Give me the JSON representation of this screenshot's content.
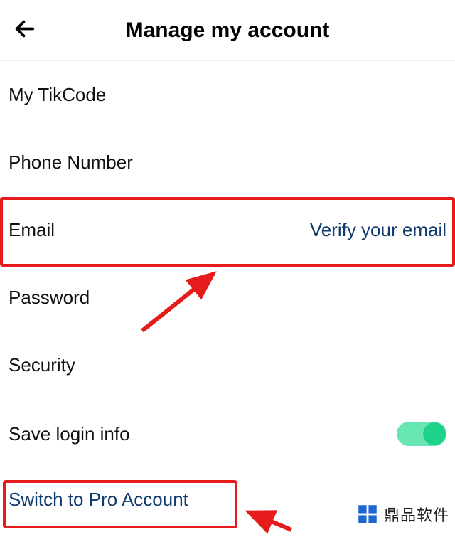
{
  "header": {
    "title": "Manage my account"
  },
  "items": {
    "tikcode": {
      "label": "My TikCode"
    },
    "phone": {
      "label": "Phone Number"
    },
    "email": {
      "label": "Email",
      "value": "Verify your email"
    },
    "password": {
      "label": "Password"
    },
    "security": {
      "label": "Security"
    },
    "savelogin": {
      "label": "Save login info"
    }
  },
  "switch_pro": {
    "label": "Switch to Pro Account"
  },
  "watermark": {
    "text": "鼎品软件"
  }
}
